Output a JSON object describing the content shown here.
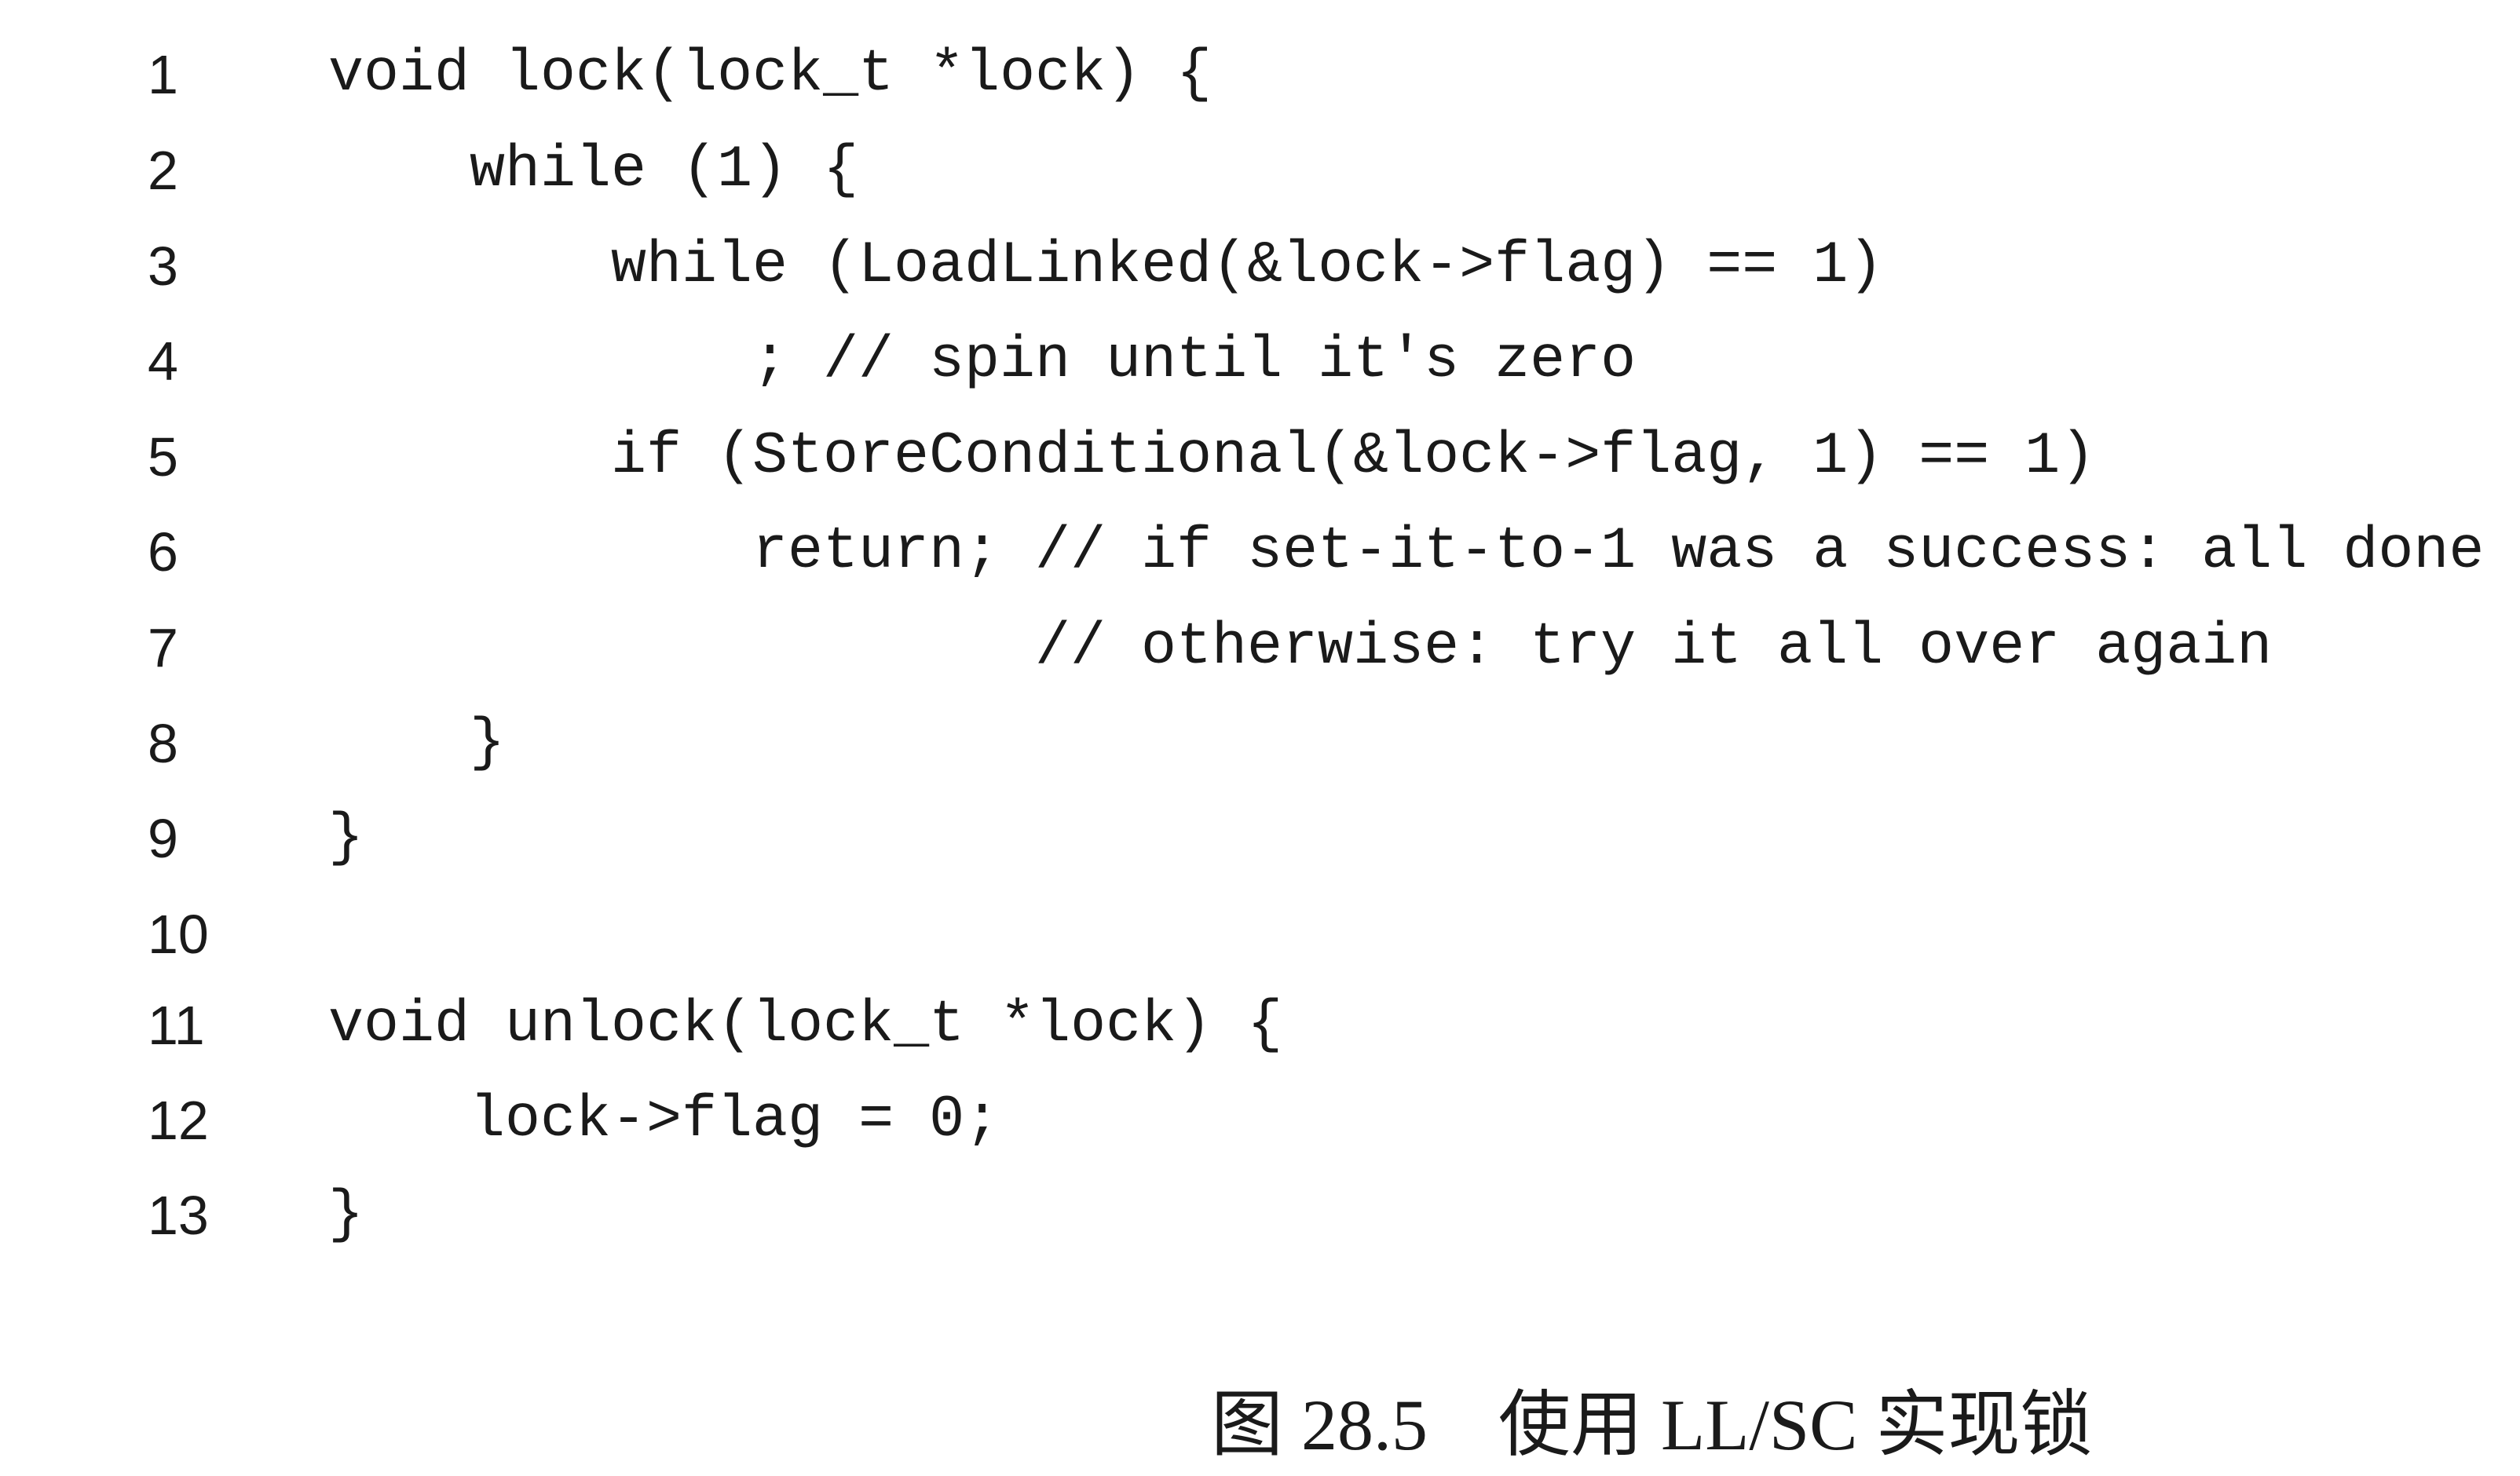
{
  "figure": {
    "lines": [
      {
        "num": "1",
        "indent": 0,
        "code": "void lock(lock_t *lock) {"
      },
      {
        "num": "2",
        "indent": 1,
        "code": "while (1) {"
      },
      {
        "num": "3",
        "indent": 2,
        "code": "while (LoadLinked(&lock->flag) == 1)"
      },
      {
        "num": "4",
        "indent": 3,
        "code": "; // spin until it's zero"
      },
      {
        "num": "5",
        "indent": 2,
        "code": "if (StoreConditional(&lock->flag, 1) == 1)"
      },
      {
        "num": "6",
        "indent": 3,
        "code": "return; // if set-it-to-1 was a success: all done"
      },
      {
        "num": "7",
        "indent": 5,
        "code": "// otherwise: try it all over again"
      },
      {
        "num": "8",
        "indent": 1,
        "code": "}"
      },
      {
        "num": "9",
        "indent": 0,
        "code": "}"
      },
      {
        "num": "10",
        "indent": 0,
        "code": ""
      },
      {
        "num": "11",
        "indent": 0,
        "code": "void unlock(lock_t *lock) {"
      },
      {
        "num": "12",
        "indent": 1,
        "code": "lock->flag = 0;"
      },
      {
        "num": "13",
        "indent": 0,
        "code": "}"
      }
    ],
    "caption": {
      "label": "图 28.5",
      "title": "使用 LL/SC 实现锁"
    }
  }
}
